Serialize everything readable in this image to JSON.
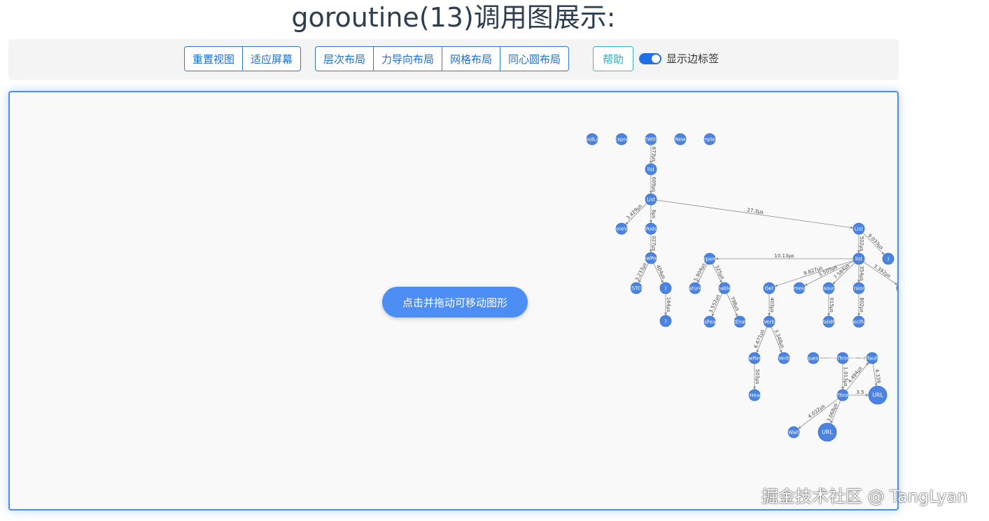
{
  "title": "goroutine(13)调用图展示:",
  "toolbar": {
    "view_buttons": [
      "重置视图",
      "适应屏幕"
    ],
    "layout_buttons": [
      "层次布局",
      "力导向布局",
      "网格布局",
      "同心圆布局"
    ],
    "help_label": "帮助",
    "edge_label_toggle": {
      "label": "显示边标签",
      "on": true
    }
  },
  "canvas": {
    "hint": "点击并拖动可移动图形",
    "accent_color": "#4a8df0",
    "node_color": "#4a84e0"
  },
  "graph": {
    "nodes": [
      {
        "id": "n1",
        "label": "isCoolLat..."
      },
      {
        "id": "n2",
        "label": "isExpre..."
      },
      {
        "id": "n3",
        "label": "ListWith..."
      },
      {
        "id": "n4",
        "label": "New"
      },
      {
        "id": "n5",
        "label": "Simplef..."
      },
      {
        "id": "n6",
        "label": "list"
      },
      {
        "id": "n7",
        "label": "List"
      },
      {
        "id": "n8",
        "label": "CoreV1"
      },
      {
        "id": "n9",
        "label": "Pods"
      },
      {
        "id": "n10",
        "label": "newPods"
      },
      {
        "id": "n11",
        "label": "RESTCl..."
      },
      {
        "id": "n12",
        "label": ")"
      },
      {
        "id": "n13",
        "label": ")"
      },
      {
        "id": "n14",
        "label": "List"
      },
      {
        "id": "n15",
        "label": "list"
      },
      {
        "id": "n16",
        "label": ")"
      },
      {
        "id": "n17",
        "label": "Prepare..."
      },
      {
        "id": "n18",
        "label": "Feature..."
      },
      {
        "id": "n19",
        "label": "Enabled"
      },
      {
        "id": "n20",
        "label": "wasFeat..."
      },
      {
        "id": "n21",
        "label": "getEnab..."
      },
      {
        "id": "n22",
        "label": "Get"
      },
      {
        "id": "n23",
        "label": "Verb"
      },
      {
        "id": "n24",
        "label": "NewReq..."
      },
      {
        "id": "n25",
        "label": "Verb"
      },
      {
        "id": "n26",
        "label": "SetHeader"
      },
      {
        "id": "n27",
        "label": "Namesp..."
      },
      {
        "id": "n28",
        "label": "Resource"
      },
      {
        "id": "n29",
        "label": "Version..."
      },
      {
        "id": "n30",
        "label": "isValidR..."
      },
      {
        "id": "n31",
        "label": "Specific..."
      },
      {
        "id": "n32",
        "label": "T"
      },
      {
        "id": "n33",
        "label": "request..."
      },
      {
        "id": "n34",
        "label": "tryThrottle"
      },
      {
        "id": "n35",
        "label": "default..."
      },
      {
        "id": "n36",
        "label": "tryThrott..."
      },
      {
        "id": "n37",
        "label": "URL"
      },
      {
        "id": "n38",
        "label": "Wait"
      },
      {
        "id": "n39",
        "label": "URL"
      }
    ],
    "edges": [
      {
        "from": "n3",
        "to": "n6",
        "label": "673μs"
      },
      {
        "from": "n6",
        "to": "n7",
        "label": "609μs"
      },
      {
        "from": "n7",
        "to": "n8",
        "label": "3.429μs"
      },
      {
        "from": "n7",
        "to": "n9",
        "label": "6μs"
      },
      {
        "from": "n7",
        "to": "n14",
        "label": "27.3μs"
      },
      {
        "from": "n9",
        "to": "n10",
        "label": "027μs"
      },
      {
        "from": "n10",
        "to": "n11",
        "label": "3.233μs"
      },
      {
        "from": "n10",
        "to": "n12",
        "label": "404μs"
      },
      {
        "from": "n12",
        "to": "n13",
        "label": "164μs"
      },
      {
        "from": "n14",
        "to": "n15",
        "label": "502μs"
      },
      {
        "from": "n14",
        "to": "n16",
        "label": "9.033μs"
      },
      {
        "from": "n15",
        "to": "n17",
        "label": "10.13μs"
      },
      {
        "from": "n17",
        "to": "n18",
        "label": "5.904μs"
      },
      {
        "from": "n17",
        "to": "n19",
        "label": "325μs"
      },
      {
        "from": "n19",
        "to": "n20",
        "label": "3.552μs"
      },
      {
        "from": "n19",
        "to": "n21",
        "label": "798μs"
      },
      {
        "from": "n15",
        "to": "n22",
        "label": "9.827μs"
      },
      {
        "from": "n22",
        "to": "n23",
        "label": "403μs"
      },
      {
        "from": "n23",
        "to": "n24",
        "label": "6.671μs"
      },
      {
        "from": "n23",
        "to": "n25",
        "label": "3.348μs"
      },
      {
        "from": "n24",
        "to": "n26",
        "label": "503μs"
      },
      {
        "from": "n15",
        "to": "n27",
        "label": "3.505μs"
      },
      {
        "from": "n15",
        "to": "n28",
        "label": "7.584μs"
      },
      {
        "from": "n15",
        "to": "n29",
        "label": "354μs"
      },
      {
        "from": "n15",
        "to": "n32",
        "label": "3.392μs"
      },
      {
        "from": "n28",
        "to": "n30",
        "label": "015μs"
      },
      {
        "from": "n29",
        "to": "n31",
        "label": "802μs"
      },
      {
        "from": "n34",
        "to": "n36",
        "label": "1.013μs"
      },
      {
        "from": "n36",
        "to": "n38",
        "label": "4.022μs"
      },
      {
        "from": "n36",
        "to": "n39",
        "label": "3.068μs"
      },
      {
        "from": "n35",
        "to": "n37",
        "label": "4.339"
      },
      {
        "from": "n36",
        "to": "n37",
        "label": "3.5"
      },
      {
        "from": "n36",
        "to": "n35",
        "label": "4.494μs"
      },
      {
        "from": "n34",
        "to": "n35",
        "label": ""
      },
      {
        "from": "n33",
        "to": "n35",
        "label": ""
      }
    ]
  },
  "watermark": "掘金技术社区 @ TangLyan"
}
